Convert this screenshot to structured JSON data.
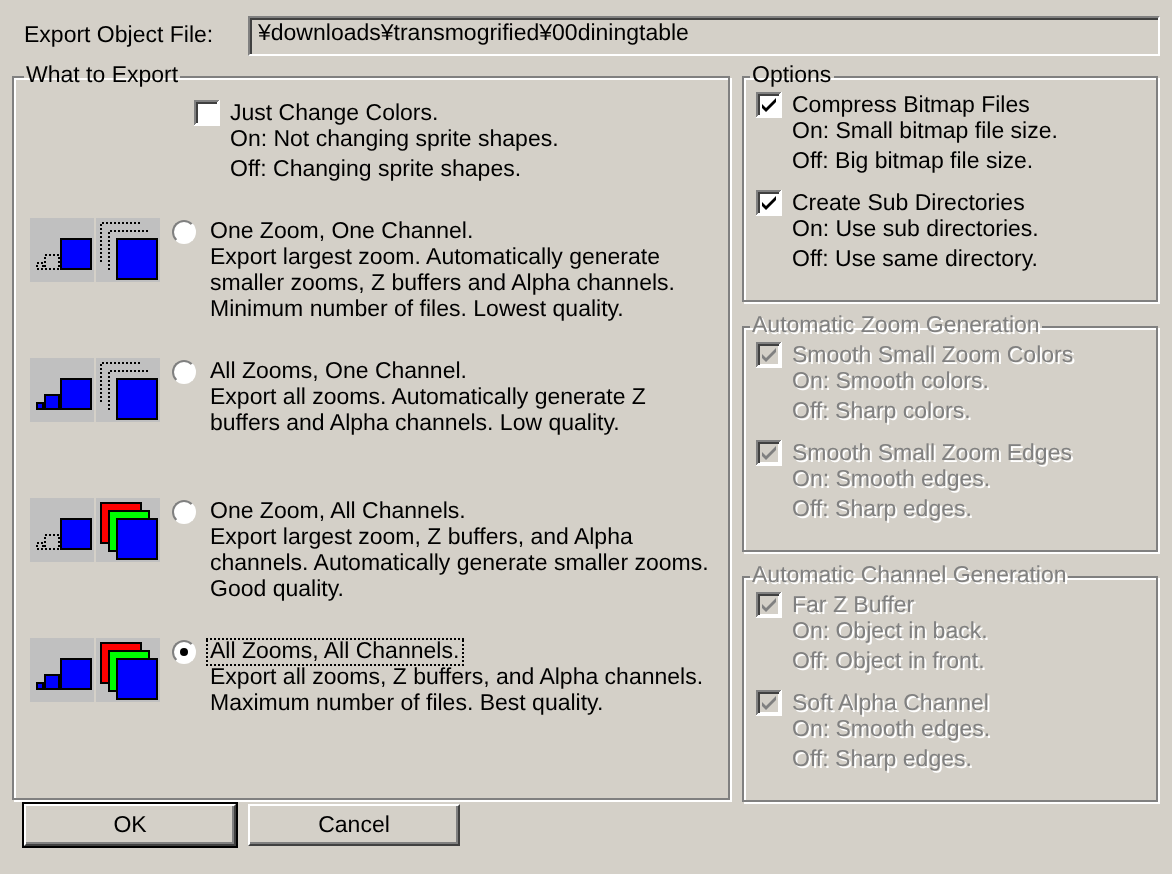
{
  "export_file": {
    "label": "Export Object File:",
    "value": "¥downloads¥transmogrified¥00diningtable"
  },
  "what_to_export": {
    "title": "What to Export",
    "change_colors": {
      "label": "Just Change Colors.",
      "checked": false,
      "on": "On: Not changing sprite shapes.",
      "off": "Off: Changing sprite shapes."
    },
    "modes": [
      {
        "label": "One Zoom, One Channel.",
        "all_zooms": false,
        "all_channels": false,
        "selected": false,
        "description": "Export largest zoom. Automatically generate smaller zooms, Z buffers and Alpha channels. Minimum number of files. Lowest quality."
      },
      {
        "label": "All Zooms, One Channel.",
        "all_zooms": true,
        "all_channels": false,
        "selected": false,
        "description": "Export all zooms. Automatically generate Z buffers and Alpha channels. Low quality."
      },
      {
        "label": "One Zoom, All Channels.",
        "all_zooms": false,
        "all_channels": true,
        "selected": false,
        "description": "Export largest zoom, Z buffers, and Alpha channels. Automatically generate smaller zooms. Good quality."
      },
      {
        "label": "All Zooms, All Channels.",
        "all_zooms": true,
        "all_channels": true,
        "selected": true,
        "description": "Export all zooms, Z buffers, and Alpha channels. Maximum number of files. Best quality."
      }
    ]
  },
  "option_groups": [
    {
      "title": "Options",
      "disabled": false,
      "items": [
        {
          "label": "Compress Bitmap Files",
          "checked": true,
          "on": "On: Small bitmap file size.",
          "off": "Off: Big bitmap file size."
        },
        {
          "label": "Create Sub Directories",
          "checked": true,
          "on": "On: Use sub directories.",
          "off": "Off: Use same directory."
        }
      ]
    },
    {
      "title": "Automatic Zoom Generation",
      "disabled": true,
      "items": [
        {
          "label": "Smooth Small Zoom Colors",
          "checked": true,
          "on": "On: Smooth colors.",
          "off": "Off: Sharp colors."
        },
        {
          "label": "Smooth Small Zoom Edges",
          "checked": true,
          "on": "On: Smooth edges.",
          "off": "Off: Sharp edges."
        }
      ]
    },
    {
      "title": "Automatic Channel Generation",
      "disabled": true,
      "items": [
        {
          "label": "Far Z Buffer",
          "checked": true,
          "on": "On: Object in back.",
          "off": "Off: Object in front."
        },
        {
          "label": "Soft Alpha Channel",
          "checked": true,
          "on": "On: Smooth edges.",
          "off": "Off: Sharp edges."
        }
      ]
    }
  ],
  "buttons": [
    {
      "label": "OK",
      "default": true
    },
    {
      "label": "Cancel",
      "default": false
    }
  ]
}
